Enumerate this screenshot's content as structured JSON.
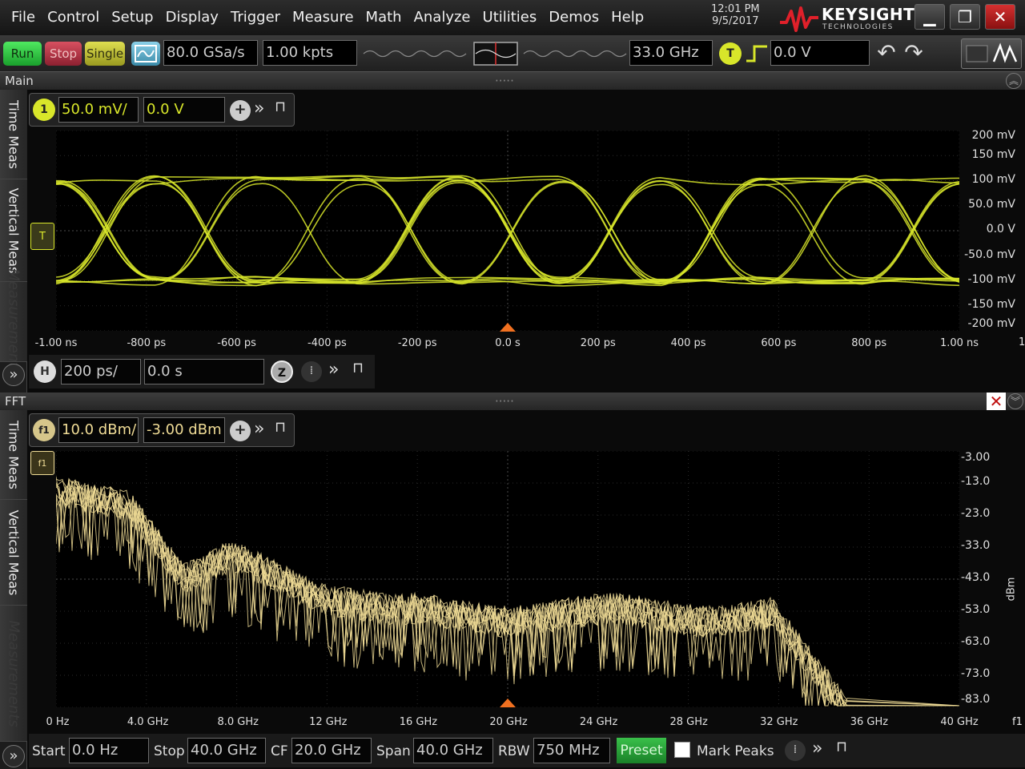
{
  "menu": [
    "File",
    "Control",
    "Setup",
    "Display",
    "Trigger",
    "Measure",
    "Math",
    "Analyze",
    "Utilities",
    "Demos",
    "Help"
  ],
  "datetime": {
    "time": "12:01 PM",
    "date": "9/5/2017"
  },
  "brand": {
    "name": "KEYSIGHT",
    "sub": "TECHNOLOGIES"
  },
  "toolbar": {
    "run": "Run",
    "stop": "Stop",
    "single": "Single",
    "sample_rate": "80.0 GSa/s",
    "memory_depth": "1.00 kpts",
    "bandwidth": "33.0 GHz",
    "trigger_badge": "T",
    "trigger_level": "0.0 V"
  },
  "main_panel": {
    "title": "Main",
    "channel_badge": "1",
    "scale": "50.0 mV/",
    "offset": "0.0 V",
    "trigger_marker": "T",
    "y_ticks": [
      "200 mV",
      "150 mV",
      "100 mV",
      "50.0 mV",
      "0.0 V",
      "-50.0 mV",
      "-100 mV",
      "-150 mV",
      "-200 mV"
    ],
    "x_ticks": [
      "-1.00 ns",
      "-800 ps",
      "-600 ps",
      "-400 ps",
      "-200 ps",
      "0.0 s",
      "200 ps",
      "400 ps",
      "600 ps",
      "800 ps",
      "1.00 ns"
    ],
    "x_edge_label": "1",
    "h_badge": "H",
    "timebase": "200 ps/",
    "delay": "0.0 s",
    "zoom_badge": "Z"
  },
  "fft_panel": {
    "title": "FFT",
    "func_badge": "f1",
    "scale": "10.0 dBm/",
    "offset": "-3.00 dBm",
    "marker": "f1",
    "y_ticks": [
      "-3.00",
      "-13.0",
      "-23.0",
      "-33.0",
      "-43.0",
      "-53.0",
      "-63.0",
      "-73.0",
      "-83.0"
    ],
    "y_unit": "dBm",
    "x_ticks": [
      "0 Hz",
      "4.0 GHz",
      "8.0 GHz",
      "12 GHz",
      "16 GHz",
      "20 GHz",
      "24 GHz",
      "28 GHz",
      "32 GHz",
      "36 GHz",
      "40 GHz"
    ],
    "x_edge_label": "f1",
    "start_label": "Start",
    "start_value": "0.0 Hz",
    "stop_label": "Stop",
    "stop_value": "40.0 GHz",
    "cf_label": "CF",
    "cf_value": "20.0 GHz",
    "span_label": "Span",
    "span_value": "40.0 GHz",
    "rbw_label": "RBW",
    "rbw_value": "750 MHz",
    "preset": "Preset",
    "mark_peaks": "Mark Peaks"
  },
  "side_tabs": [
    "Time Meas",
    "Vertical Meas",
    "Measurements"
  ],
  "colors": {
    "ch1": "#d8e62a",
    "fft": "#f0dc96",
    "run": "#22c63a",
    "stop": "#c03a4a",
    "single": "#c8c83a",
    "brand_red": "#e0202a"
  },
  "icons": [
    "add-icon",
    "expand-icon",
    "pin-icon",
    "undo-icon",
    "redo-icon",
    "close-icon",
    "minimize-icon",
    "maximize-icon",
    "auto-scale-icon",
    "stop-flash-icon"
  ]
}
